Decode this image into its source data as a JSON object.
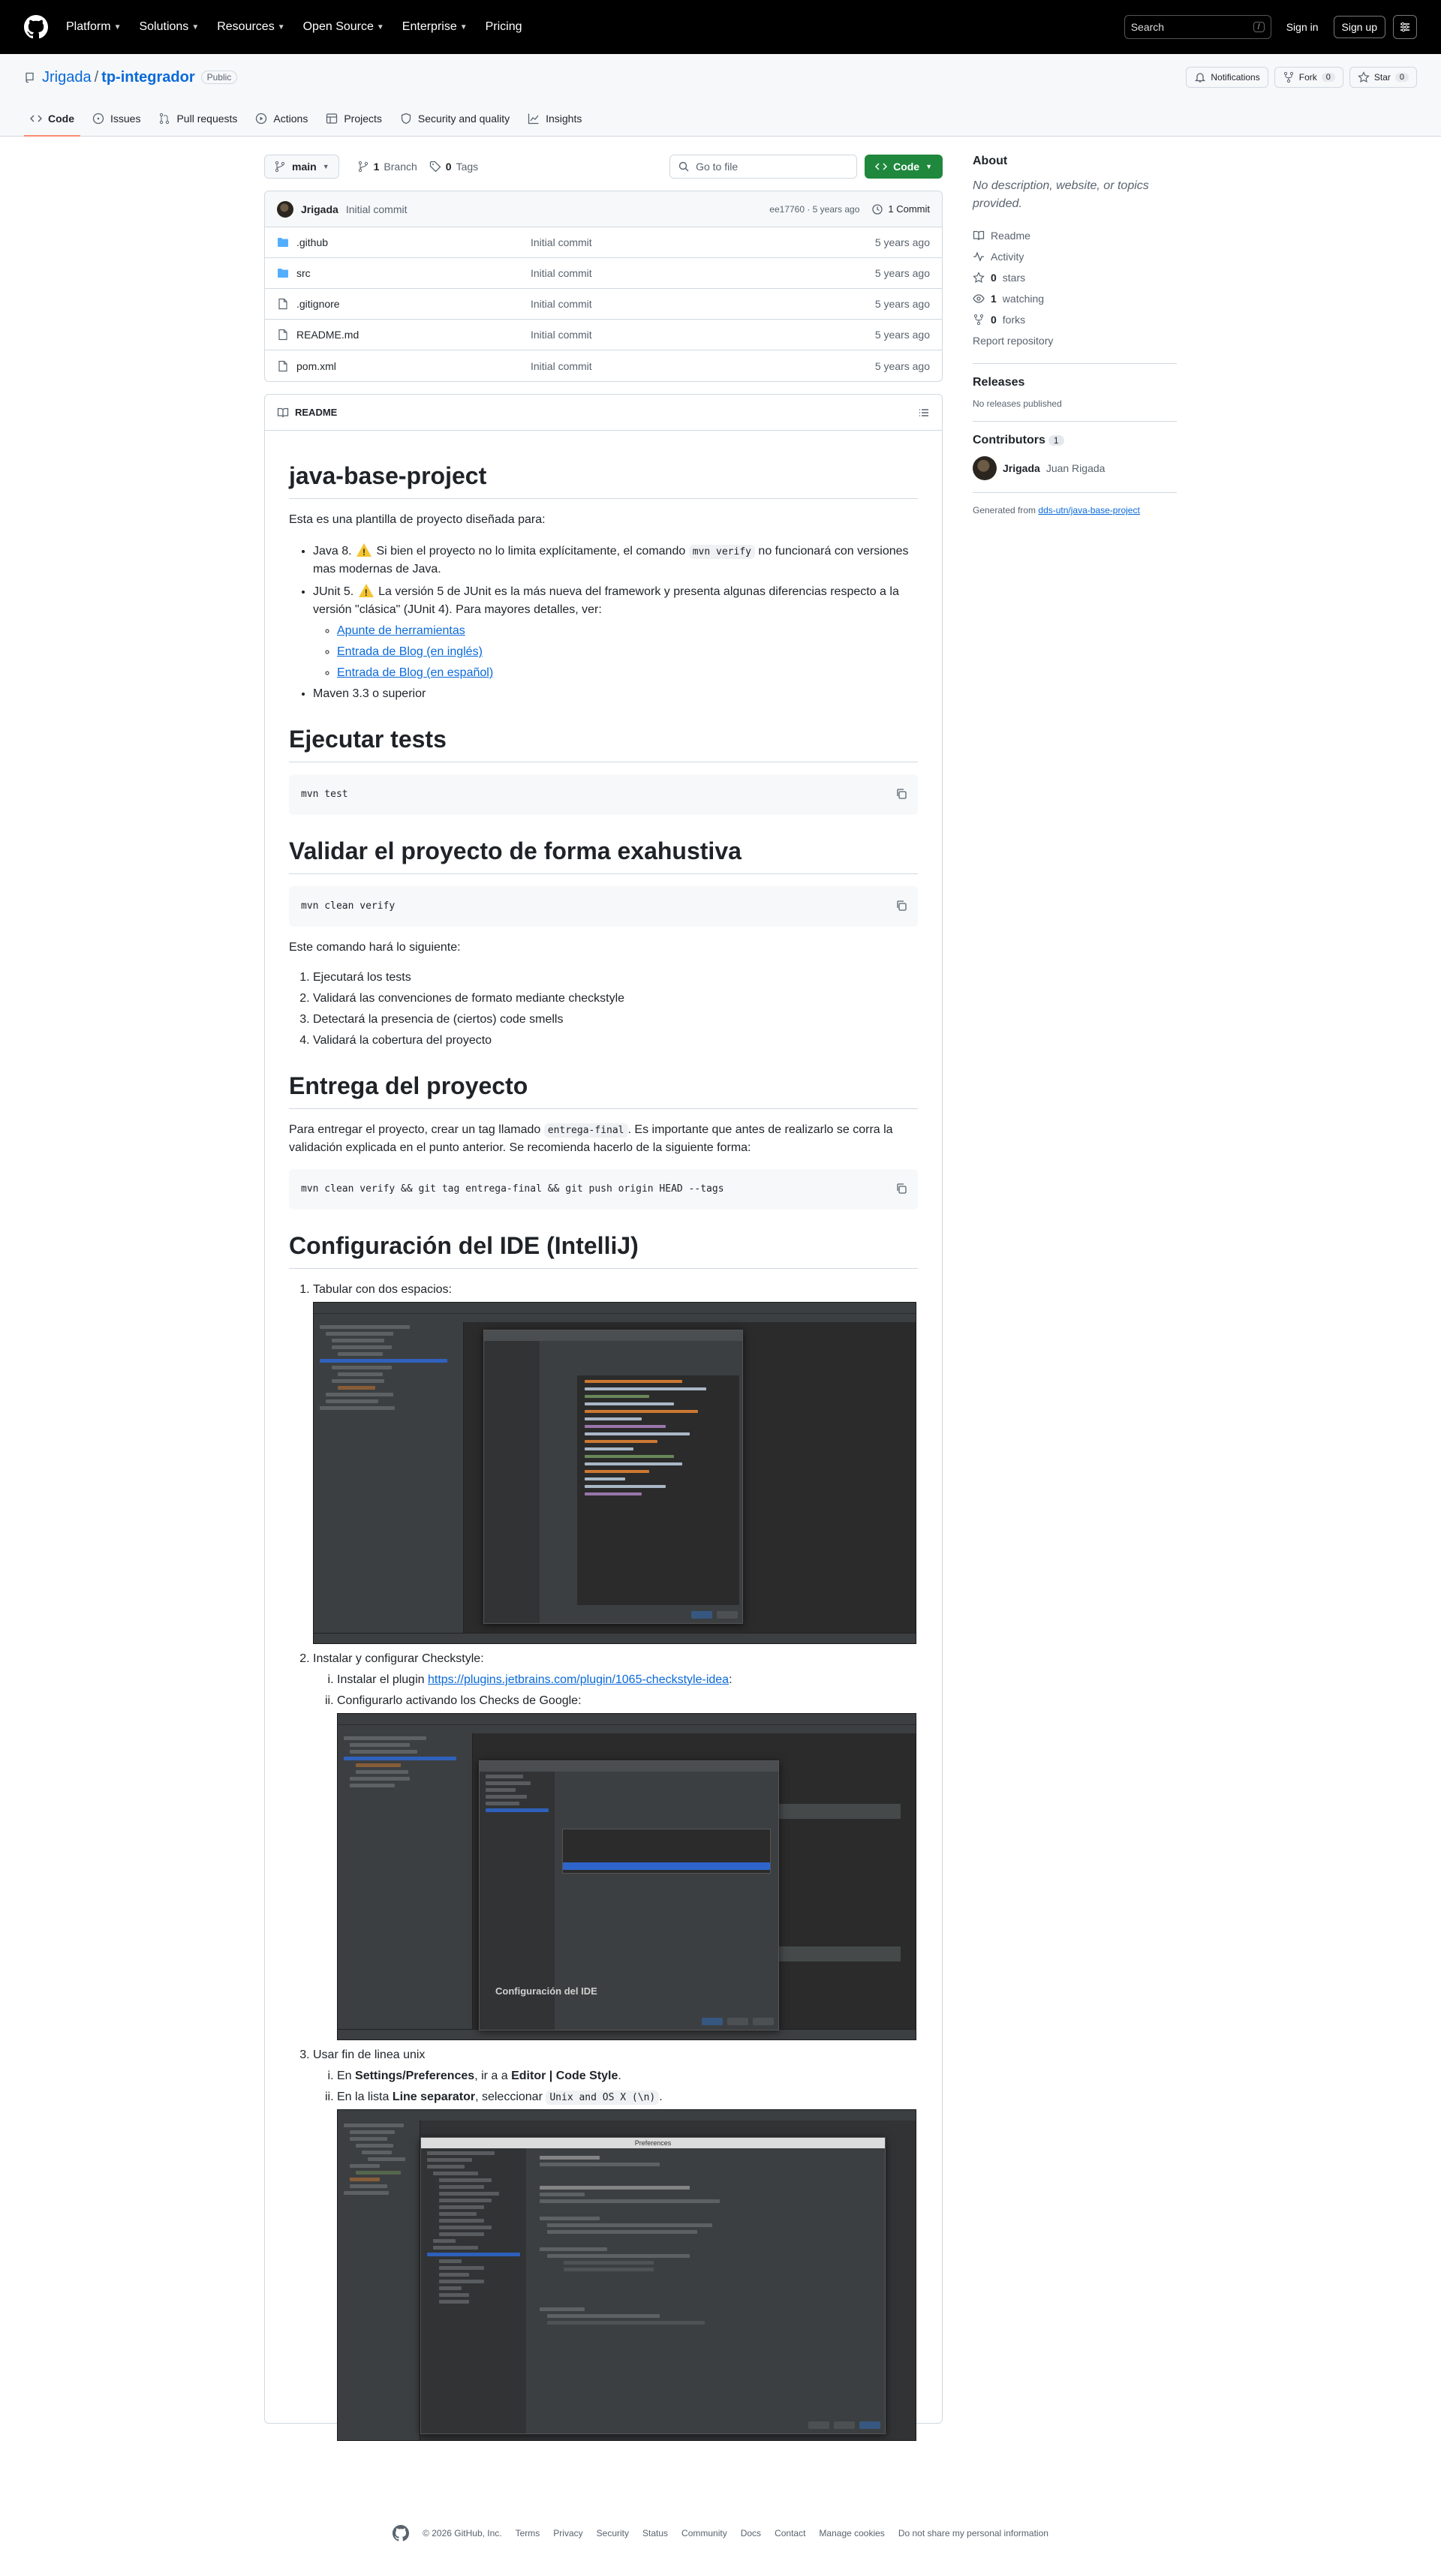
{
  "header": {
    "nav": [
      "Platform",
      "Solutions",
      "Resources",
      "Open Source",
      "Enterprise",
      "Pricing"
    ],
    "search_label": "Search",
    "search_hint": "/",
    "signin": "Sign in",
    "signup": "Sign up"
  },
  "repo": {
    "owner": "Jrigada",
    "name": "tp-integrador",
    "visibility": "Public",
    "notifications": "Notifications",
    "fork_label": "Fork",
    "fork_count": "0",
    "star_label": "Star",
    "star_count": "0",
    "tabs": [
      "Code",
      "Issues",
      "Pull requests",
      "Actions",
      "Projects",
      "Security and quality",
      "Insights"
    ]
  },
  "branchbar": {
    "branch": "main",
    "branches_count": "1",
    "branches_label": "Branch",
    "tags_count": "0",
    "tags_label": "Tags",
    "goto_placeholder": "Go to file",
    "code_button": "Code"
  },
  "commit": {
    "author": "Jrigada",
    "message": "Initial commit",
    "hash_time": "ee17760 · 5 years ago",
    "count": "1 Commit"
  },
  "files": [
    {
      "name": ".github",
      "type": "dir",
      "msg": "Initial commit",
      "age": "5 years ago"
    },
    {
      "name": "src",
      "type": "dir",
      "msg": "Initial commit",
      "age": "5 years ago"
    },
    {
      "name": ".gitignore",
      "type": "file",
      "msg": "Initial commit",
      "age": "5 years ago"
    },
    {
      "name": "README.md",
      "type": "file",
      "msg": "Initial commit",
      "age": "5 years ago"
    },
    {
      "name": "pom.xml",
      "type": "file",
      "msg": "Initial commit",
      "age": "5 years ago"
    }
  ],
  "readme": {
    "tab": "README",
    "title": "java-base-project",
    "intro": "Esta es una plantilla de proyecto diseñada para:",
    "req_java_a": "Java 8. ",
    "req_java_b": " Si bien el proyecto no lo limita explícitamente, el comando ",
    "req_java_code": "mvn verify",
    "req_java_c": " no funcionará con versiones mas modernas de Java.",
    "req_junit_a": "JUnit 5. ",
    "req_junit_b": " La versión 5 de JUnit es la más nueva del framework y presenta algunas diferencias respecto a la versión \"clásica\" (JUnit 4). Para mayores detalles, ver:",
    "junit_links": [
      "Apunte de herramientas",
      "Entrada de Blog (en inglés)",
      "Entrada de Blog (en español)"
    ],
    "req_maven": "Maven 3.3 o superior",
    "h_tests": "Ejecutar tests",
    "code_test": "mvn test",
    "h_validate": "Validar el proyecto de forma exahustiva",
    "code_verify": "mvn clean verify",
    "validate_intro": "Este comando hará lo siguiente:",
    "validate_steps": [
      "Ejecutará los tests",
      "Validará las convenciones de formato mediante checkstyle",
      "Detectará la presencia de (ciertos) code smells",
      "Validará la cobertura del proyecto"
    ],
    "h_entrega": "Entrega del proyecto",
    "entrega_a": "Para entregar el proyecto, crear un tag llamado ",
    "entrega_code": "entrega-final",
    "entrega_b": ". Es importante que antes de realizarlo se corra la validación explicada en el punto anterior. Se recomienda hacerlo de la siguiente forma:",
    "code_entrega": "mvn clean verify && git tag entrega-final && git push origin HEAD --tags",
    "h_ide": "Configuración del IDE (IntelliJ)",
    "ide_step1": "Tabular con dos espacios:",
    "ide_step2": "Instalar y configurar Checkstyle:",
    "ide_step2_a": "Instalar el plugin ",
    "ide_step2_link": "https://plugins.jetbrains.com/plugin/1065-checkstyle-idea",
    "ide_step2_a_end": ":",
    "ide_step2_b": "Configurarlo activando los Checks de Google:",
    "ide_step2_overlay": "Configuración del IDE",
    "ide_step3": "Usar fin de linea unix",
    "ide_step3_a1": "En ",
    "ide_step3_a_bold": "Settings/Preferences",
    "ide_step3_a2": ", ir a a ",
    "ide_step3_a_bold2": "Editor | Code Style",
    "ide_step3_a3": ".",
    "ide_step3_b1": "En la lista ",
    "ide_step3_b_bold": "Line separator",
    "ide_step3_b2": ", seleccionar ",
    "ide_step3_b_code": "Unix and OS X (\\n)",
    "ide_step3_b3": ".",
    "ide_dialog_title": "Preferences"
  },
  "sidebar": {
    "about_title": "About",
    "about_desc": "No description, website, or topics provided.",
    "readme": "Readme",
    "activity": "Activity",
    "stars_count": "0",
    "stars_label": "stars",
    "watching_count": "1",
    "watching_label": "watching",
    "forks_count": "0",
    "forks_label": "forks",
    "report": "Report repository",
    "releases_title": "Releases",
    "releases_desc": "No releases published",
    "contributors_title": "Contributors",
    "contributors_count": "1",
    "contributor_login": "Jrigada",
    "contributor_name": "Juan Rigada",
    "generated_from_label": "Generated from",
    "generated_from_link": "dds-utn/java-base-project"
  },
  "footer": {
    "copyright": "© 2026 GitHub, Inc.",
    "links": [
      "Terms",
      "Privacy",
      "Security",
      "Status",
      "Community",
      "Docs",
      "Contact",
      "Manage cookies",
      "Do not share my personal information"
    ]
  }
}
